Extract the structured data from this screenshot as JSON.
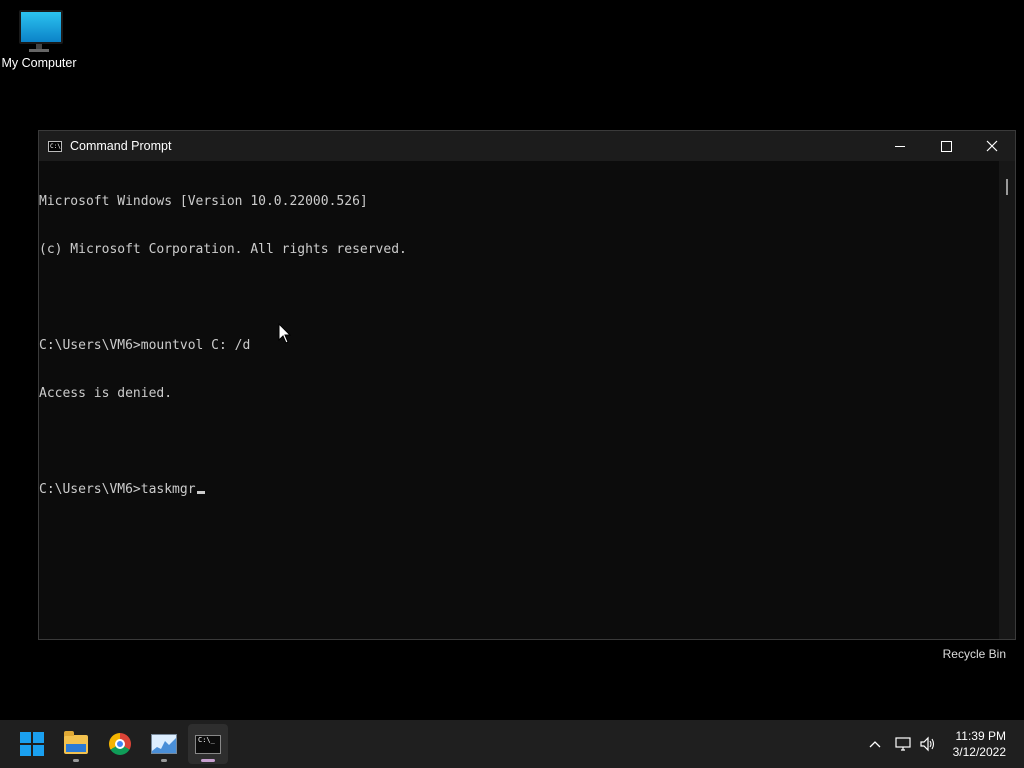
{
  "desktop": {
    "icons": [
      {
        "label": "My Computer",
        "icon": "computer-icon"
      },
      {
        "label": "Recycle Bin",
        "icon": "recycle-bin-icon"
      }
    ]
  },
  "window": {
    "title": "Command Prompt",
    "icon": "cmd-icon",
    "controls": {
      "minimize": "minimize-icon",
      "maximize": "maximize-icon",
      "close": "close-icon"
    },
    "console_lines": [
      "Microsoft Windows [Version 10.0.22000.526]",
      "(c) Microsoft Corporation. All rights reserved.",
      "",
      "C:\\Users\\VM6>mountvol C: /d",
      "Access is denied.",
      "",
      "C:\\Users\\VM6>taskmgr"
    ]
  },
  "taskbar": {
    "apps": [
      {
        "name": "Start",
        "icon": "windows-logo-icon"
      },
      {
        "name": "File Explorer",
        "icon": "folder-icon"
      },
      {
        "name": "Google Chrome",
        "icon": "chrome-icon"
      },
      {
        "name": "Performance Monitor",
        "icon": "perfmon-icon"
      },
      {
        "name": "Command Prompt",
        "icon": "terminal-icon"
      }
    ],
    "tray": {
      "icons": [
        "chevron-up-icon",
        "network-icon",
        "speaker-icon"
      ],
      "time": "11:39 PM",
      "date": "3/12/2022"
    }
  },
  "colors": {
    "desktop_bg": "#000000",
    "console_bg": "#0c0c0c",
    "console_text": "#cccccc",
    "taskbar_bg": "#1f1f1f",
    "accent": "#1aa0f0"
  }
}
